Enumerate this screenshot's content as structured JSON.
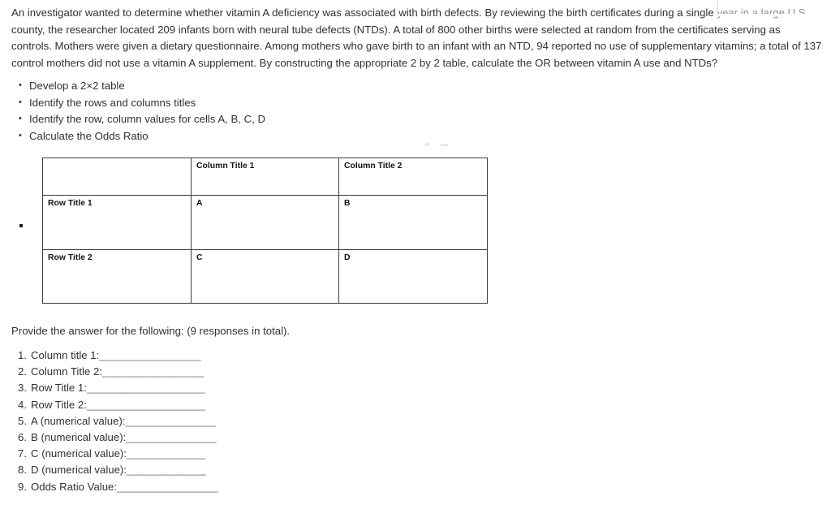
{
  "intro": {
    "visible_text": "An investigator wanted to determine whether vitamin A deficiency was associated with birth defects. By reviewing the birth certificates during a single year in a large U.S. county, the researcher located 209 infants born with neural tube defects (NTDs). A total of 800 other births were selected at random from the certificates serving as controls. Mothers were given a dietary questionnaire. Among mothers who gave birth to an infant with an NTD, 94 reported no use of supplementary vitamins; a total of 137 control mothers did not use a vitamin A supplement. By constructing the appropriate 2 by 2 table, calculate the OR between vitamin A use and NTDs?",
    "clear_part": "An investigator wanted to determine whether vitamin A deficiency was associated with birth defects. By reviewing the birth certificates during a single ",
    "faded_part": "year in a large U.S.",
    "rest": " county, the researcher located 209 infants born with neural tube defects (NTDs). A total of 800 other births were selected at random from the certificates serving as controls. Mothers were given a dietary questionnaire. Among mothers who gave birth to an infant with an NTD, 94 reported no use of supplementary vitamins; a total of 137 control mothers did not use a vitamin A supplement. By constructing the appropriate 2 by 2 table, calculate the OR between vitamin A use and NTDs?"
  },
  "task_list": {
    "items": [
      "Develop a 2×2 table",
      "Identify the rows and columns titles",
      "Identify the row, column values for cells A, B, C, D",
      "Calculate the Odds Ratio"
    ]
  },
  "table": {
    "corner": "",
    "column_headers": [
      "Column Title 1",
      "Column Title 2"
    ],
    "rows": [
      {
        "row_title": "Row Title 1",
        "cells": [
          "A",
          "B"
        ]
      },
      {
        "row_title": "Row Title 2",
        "cells": [
          "C",
          "D"
        ]
      }
    ]
  },
  "answer_section": {
    "prompt": "Provide the answer for the following: (9 responses in total).",
    "items": [
      {
        "label": "Column title 1:",
        "blank": "__________________"
      },
      {
        "label": "Column Title 2:",
        "blank": "__________________"
      },
      {
        "label": "Row Title 1:",
        "blank": "_____________________"
      },
      {
        "label": "Row Title 2:",
        "blank": "_____________________"
      },
      {
        "label": "A (numerical value):",
        "blank": "________________"
      },
      {
        "label": "B (numerical value):",
        "blank": "________________"
      },
      {
        "label": "C (numerical value):",
        "blank": "______________"
      },
      {
        "label": "D (numerical value):",
        "blank": "______________"
      },
      {
        "label": "Odds Ratio Value:",
        "blank": "__________________"
      }
    ]
  },
  "colors": {
    "page_background": "#ffffff",
    "body_text": "#2f3134",
    "faded_text": "#8d8f93",
    "table_border": "#3c3c3c",
    "table_text": "#141414",
    "blank_line": "#6f7174"
  }
}
